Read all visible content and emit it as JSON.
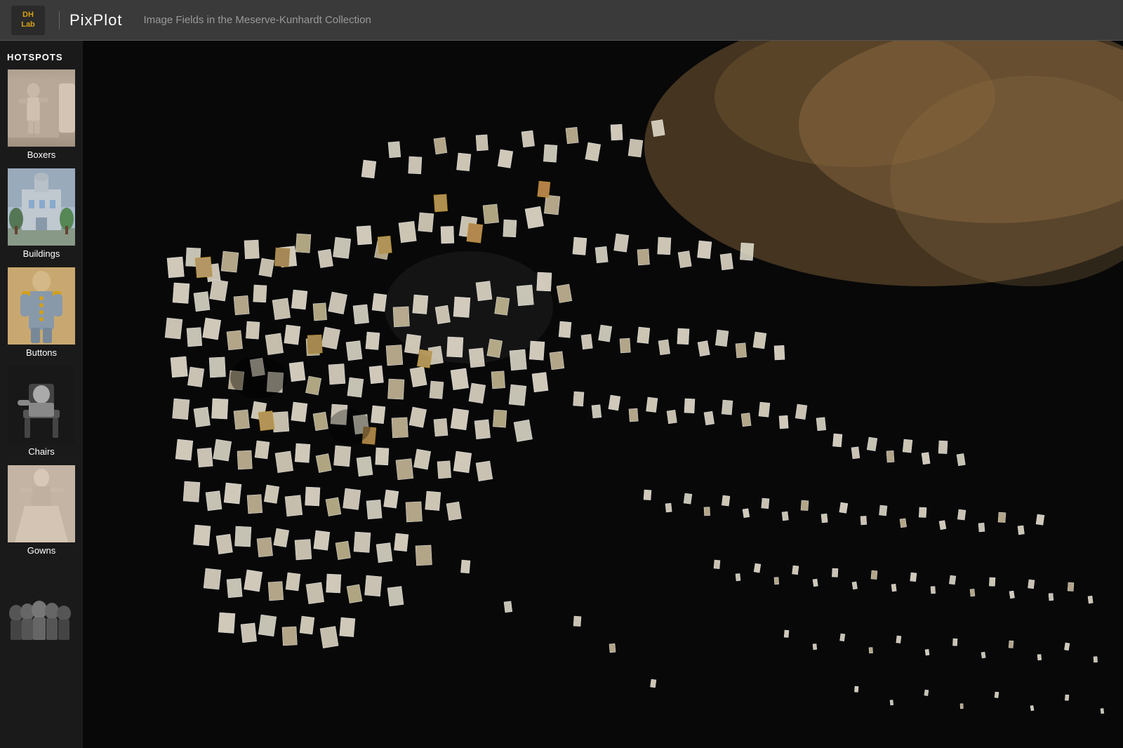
{
  "header": {
    "logo_line1": "DH",
    "logo_line2": "Lab",
    "app_title": "PixPlot",
    "subtitle": "Image Fields in the Meserve-Kunhardt Collection"
  },
  "sidebar": {
    "section_label": "HOTSPOTS",
    "items": [
      {
        "id": "boxers",
        "label": "Boxers",
        "thumb_class": "thumb-boxers"
      },
      {
        "id": "buildings",
        "label": "Buildings",
        "thumb_class": "thumb-buildings"
      },
      {
        "id": "buttons",
        "label": "Buttons",
        "thumb_class": "thumb-buttons"
      },
      {
        "id": "chairs",
        "label": "Chairs",
        "thumb_class": "thumb-chairs"
      },
      {
        "id": "gowns",
        "label": "Gowns",
        "thumb_class": "thumb-gowns"
      },
      {
        "id": "group",
        "label": "",
        "thumb_class": "thumb-group"
      }
    ]
  },
  "visualization": {
    "description": "Scattered image cluster visualization on dark background"
  }
}
